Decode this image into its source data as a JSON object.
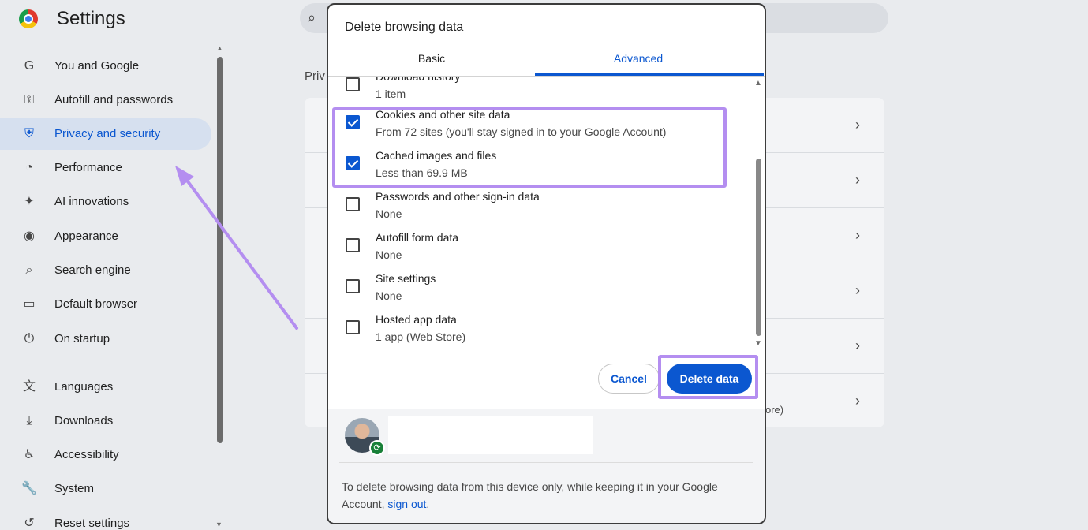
{
  "app": {
    "title": "Settings"
  },
  "sidebar": {
    "items": [
      {
        "label": "You and Google",
        "icon": "google-g-icon",
        "glyph": "G"
      },
      {
        "label": "Autofill and passwords",
        "icon": "key-icon",
        "glyph": "⚿"
      },
      {
        "label": "Privacy and security",
        "icon": "shield-icon",
        "glyph": "⛨",
        "active": true
      },
      {
        "label": "Performance",
        "icon": "speedometer-icon",
        "glyph": "◔"
      },
      {
        "label": "AI innovations",
        "icon": "sparkle-icon",
        "glyph": "✦"
      },
      {
        "label": "Appearance",
        "icon": "palette-icon",
        "glyph": "◉"
      },
      {
        "label": "Search engine",
        "icon": "search-icon",
        "glyph": "⌕"
      },
      {
        "label": "Default browser",
        "icon": "browser-window-icon",
        "glyph": "▭"
      },
      {
        "label": "On startup",
        "icon": "power-icon",
        "glyph": "⏻"
      },
      {
        "label": "Languages",
        "icon": "translate-icon",
        "glyph": "文"
      },
      {
        "label": "Downloads",
        "icon": "download-icon",
        "glyph": "⤓"
      },
      {
        "label": "Accessibility",
        "icon": "accessibility-icon",
        "glyph": "♿"
      },
      {
        "label": "System",
        "icon": "wrench-icon",
        "glyph": "🔧"
      },
      {
        "label": "Reset settings",
        "icon": "reset-icon",
        "glyph": "↺"
      }
    ]
  },
  "background": {
    "section_label": "Priv",
    "fragments": [
      "ore)"
    ]
  },
  "dialog": {
    "title": "Delete browsing data",
    "tabs": [
      {
        "label": "Basic",
        "selected": false
      },
      {
        "label": "Advanced",
        "selected": true
      }
    ],
    "options": [
      {
        "title": "Download history",
        "subtitle": "1 item",
        "checked": false
      },
      {
        "title": "Cookies and other site data",
        "subtitle": "From 72 sites (you'll stay signed in to your Google Account)",
        "checked": true
      },
      {
        "title": "Cached images and files",
        "subtitle": "Less than 69.9 MB",
        "checked": true
      },
      {
        "title": "Passwords and other sign-in data",
        "subtitle": "None",
        "checked": false
      },
      {
        "title": "Autofill form data",
        "subtitle": "None",
        "checked": false
      },
      {
        "title": "Site settings",
        "subtitle": "None",
        "checked": false
      },
      {
        "title": "Hosted app data",
        "subtitle": "1 app (Web Store)",
        "checked": false
      }
    ],
    "cancel_label": "Cancel",
    "delete_label": "Delete data",
    "footer_text": "To delete browsing data from this device only, while keeping it in your Google Account,",
    "footer_link": "sign out",
    "footer_end": "."
  },
  "colors": {
    "accent": "#0b57d0",
    "annotation": "#b48ef0",
    "sync_badge": "#188038"
  }
}
